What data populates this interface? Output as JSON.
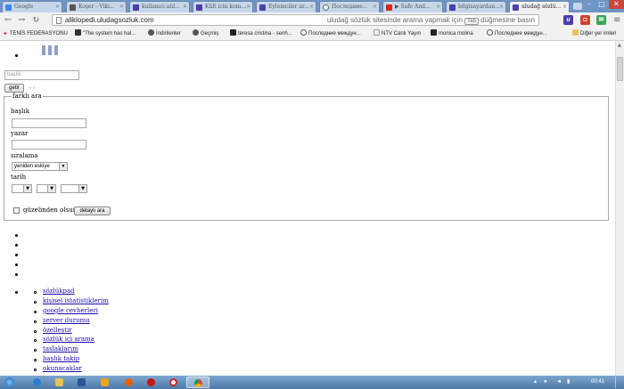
{
  "browser": {
    "tabs": [
      {
        "label": "Google",
        "icon": "google-icon",
        "color": "#4285f4"
      },
      {
        "label": "Koşer - Viki...",
        "icon": "wikipedia-icon",
        "color": "#555555"
      },
      {
        "label": "kullanıcı alıl...",
        "icon": "uludag-icon",
        "color": "#4b3fa8"
      },
      {
        "label": "Kült icin kom...",
        "icon": "uludag-icon",
        "color": "#4b3fa8"
      },
      {
        "label": "Eylemciler ar...",
        "icon": "uludag-icon",
        "color": "#4b3fa8"
      },
      {
        "label": "Последние...",
        "icon": "globe-icon",
        "color": "#666666"
      },
      {
        "label": "▶ Safe And...",
        "icon": "youtube-icon",
        "color": "#e62117"
      },
      {
        "label": "bilgisayardan...",
        "icon": "uludag-icon",
        "color": "#4b3fa8"
      },
      {
        "label": "uludağ sözlü...",
        "icon": "uludag-icon",
        "color": "#4b3fa8",
        "active": true
      }
    ],
    "window_controls": {
      "minimize": "–",
      "maximize": "□",
      "close": "✕"
    },
    "url": "aliklopedi.uludagsozluk.com",
    "omnibox_hint": "uludağ sözlük sitesinde arama yapmak için",
    "omnibox_key": "Tab",
    "omnibox_hint_end": "düğmesine basın",
    "bookmarks": [
      {
        "label": "TENİS FEDERASYONU",
        "icon": "tennis-icon"
      },
      {
        "label": "\"The system has hal...",
        "icon": "bookmark-icon"
      },
      {
        "label": "İndirilenler",
        "icon": "download-icon"
      },
      {
        "label": "Geçmiş",
        "icon": "history-icon"
      },
      {
        "label": "teresa cristina - senh...",
        "icon": "fz-icon"
      },
      {
        "label": "Последние междун...",
        "icon": "globe-icon"
      },
      {
        "label": "NTV Canlı Yayın",
        "icon": "page-icon"
      },
      {
        "label": "monica molina",
        "icon": "fz-icon"
      },
      {
        "label": "Последние междун...",
        "icon": "globe-icon"
      }
    ],
    "bookmarks_other": "Diğer yer imleri"
  },
  "page": {
    "search_placeholder": "başlık",
    "search_button": "getir",
    "search_arrow": "«-»",
    "legend": "farklı ara",
    "label_title": "başlık",
    "label_author": "yazar",
    "label_sort": "sıralama",
    "sort_value": "yeniden eskiye",
    "label_date": "tarih",
    "checkbox_label": "güzelinden olsun",
    "detail_button": "detaylı ara",
    "links": [
      "sözlükpad",
      "kişisel istatistiklerim",
      "google cevherleri",
      "server durumu",
      "özelleştir",
      "sözlük içi arama",
      "taslaklarım",
      "başlık takip",
      "okunacaklar"
    ]
  },
  "taskbar": {
    "clock": "00:41",
    "apps": [
      "start-orb-icon",
      "ie-icon",
      "folder-icon",
      "word-icon",
      "media-icon",
      "firefox-icon",
      "opera-icon",
      "yandex-icon",
      "chrome-icon"
    ]
  },
  "colors": {
    "tabstrip": "#6f95c4",
    "link": "#1a0dab",
    "taskbar": "#4e79a8"
  }
}
